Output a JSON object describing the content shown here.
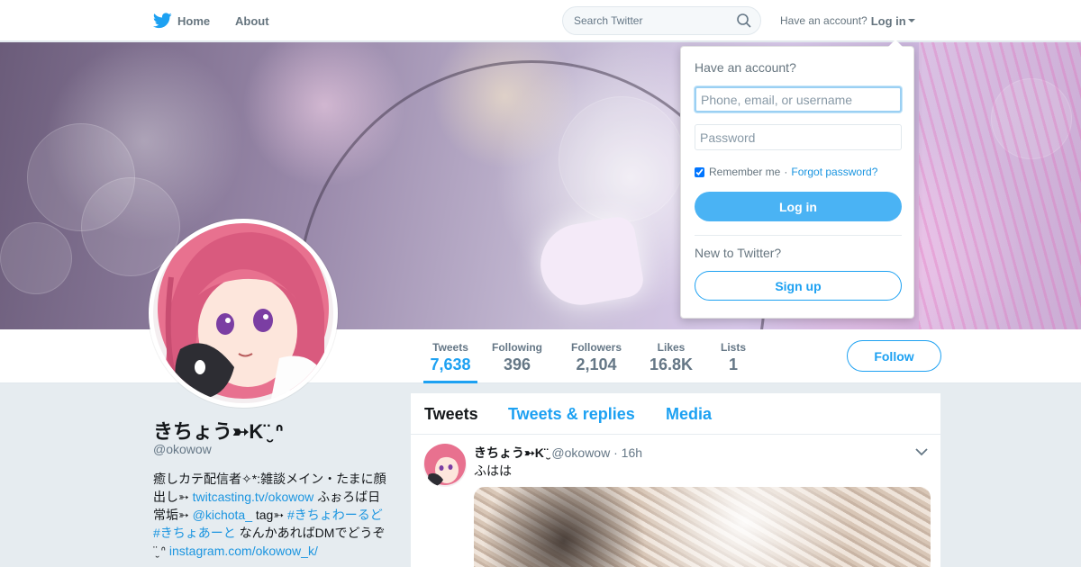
{
  "nav": {
    "home_label": "Home",
    "about_label": "About",
    "search_placeholder": "Search Twitter",
    "account_prompt": "Have an account?",
    "login_label": "Log in",
    "icons": [
      "twitter-bird-icon",
      "search-icon",
      "caret-down-icon"
    ]
  },
  "colors": {
    "brand_blue": "#1da1f2",
    "link_blue": "#1b95e0",
    "background": "#e6ecf0",
    "login_button": "#4ab3f4"
  },
  "stats": [
    {
      "label": "Tweets",
      "value": "7,638",
      "active": true
    },
    {
      "label": "Following",
      "value": "396",
      "active": false
    },
    {
      "label": "Followers",
      "value": "2,104",
      "active": false
    },
    {
      "label": "Likes",
      "value": "16.8K",
      "active": false
    },
    {
      "label": "Lists",
      "value": "1",
      "active": false
    }
  ],
  "follow_label": "Follow",
  "profile": {
    "name": "きちょう➳K¨̮ ᐢ",
    "handle": "@okowow",
    "bio": {
      "t1": "癒しカテ配信者✧*:雑談メイン・たまに顔出し➳ ",
      "link1": "twitcasting.tv/okowow",
      "t2": " ふぉろば日常垢➳ ",
      "mention": "@kichota_",
      "t3": " tag➳ ",
      "hashtag1": "#きちょわーるど",
      "t4": " ",
      "hashtag2": "#きちょあーと",
      "t5": " なんかあればDMでどうぞ ¨̮ ᐢ ",
      "link2": "instagram.com/okowow_k/"
    }
  },
  "timeline": {
    "tabs": [
      "Tweets",
      "Tweets & replies",
      "Media"
    ],
    "tweet": {
      "name": "きちょう➳K¨̮",
      "handle": "@okowow",
      "separator": "·",
      "time": "16h",
      "text": "ふはは",
      "icons": [
        "chevron-down-icon"
      ]
    }
  },
  "login_dropdown": {
    "title": "Have an account?",
    "username_placeholder": "Phone, email, or username",
    "password_placeholder": "Password",
    "remember_label": "Remember me",
    "separator": "·",
    "forgot_label": "Forgot password?",
    "remember_checked": true,
    "login_button": "Log in",
    "new_prompt": "New to Twitter?",
    "signup_button": "Sign up"
  }
}
